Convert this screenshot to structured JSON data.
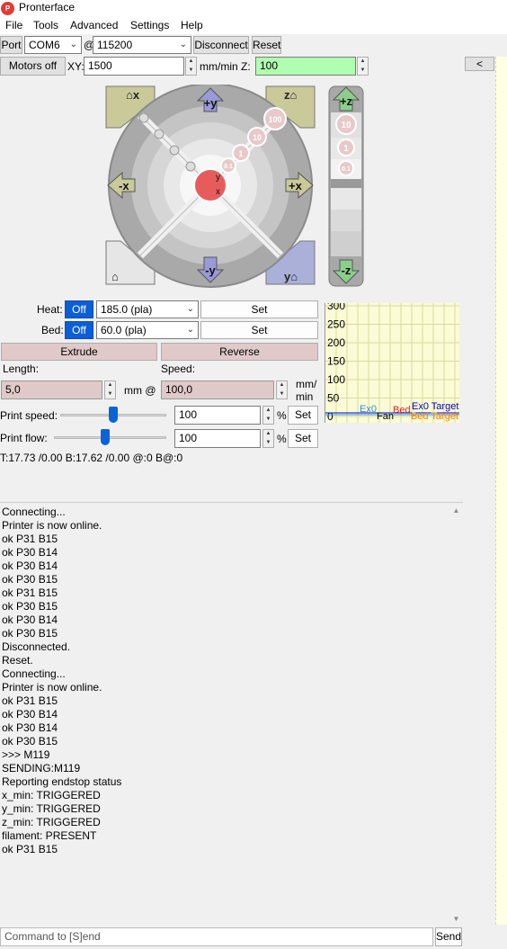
{
  "window": {
    "title": "Pronterface",
    "icon_text": "P"
  },
  "menu": [
    "File",
    "Tools",
    "Advanced",
    "Settings",
    "Help"
  ],
  "toolbar": {
    "port_label": "Port",
    "port_value": "COM6",
    "at": "@",
    "baud_value": "115200",
    "disconnect": "Disconnect",
    "reset": "Reset",
    "collapse": "<"
  },
  "motion": {
    "motors_off": "Motors off",
    "xy_label": "XY:",
    "xy_value": "1500",
    "units_label": "mm/min Z:",
    "z_value": "100"
  },
  "jog": {
    "home_x": "x",
    "home_z": "z",
    "home_y": "y",
    "home_all": "⌂",
    "plus_y": "+y",
    "minus_y": "-y",
    "plus_x": "+x",
    "minus_x": "-x",
    "center_y": "y",
    "center_x": "x",
    "steps": [
      "100",
      "10",
      "1",
      "0.1"
    ],
    "plus_z": "+z",
    "minus_z": "-z",
    "z_steps": [
      "10",
      "1",
      "0.1"
    ]
  },
  "temps": {
    "heat_label": "Heat:",
    "heat_off": "Off",
    "heat_value": "185.0 (pla)",
    "heat_set": "Set",
    "bed_label": "Bed:",
    "bed_off": "Off",
    "bed_value": "60.0 (pla)",
    "bed_set": "Set"
  },
  "extrude": {
    "extrude": "Extrude",
    "reverse": "Reverse",
    "length_label": "Length:",
    "speed_label": "Speed:",
    "length_value": "5,0",
    "length_unit": "mm @",
    "speed_value": "100,0",
    "speed_unit_1": "mm/",
    "speed_unit_2": "min"
  },
  "print_speed": {
    "label": "Print speed:",
    "value": "100",
    "unit": "%",
    "set": "Set",
    "level": 0.5
  },
  "print_flow": {
    "label": "Print flow:",
    "value": "100",
    "unit": "%",
    "set": "Set",
    "level": 0.45
  },
  "status": "T:17.73 /0.00 B:17.62 /0.00 @:0 B@:0",
  "graph": {
    "y_ticks": [
      "300",
      "250",
      "200",
      "150",
      "100",
      "50",
      "0"
    ],
    "legend": [
      {
        "text": "Ex0",
        "color": "#2a8fe6"
      },
      {
        "text": "Fan",
        "color": "#000000"
      },
      {
        "text": "Bed",
        "color": "#e02020"
      },
      {
        "text": "Ex0 Target",
        "color": "#0000cc"
      },
      {
        "text": "Bed Target",
        "color": "#ff8000"
      }
    ],
    "accent": "#fbfbd6"
  },
  "console": [
    "Connecting...",
    "Printer is now online.",
    "ok P31 B15",
    "ok P30 B14",
    "ok P30 B14",
    "ok P30 B15",
    "ok P31 B15",
    "ok P30 B15",
    "ok P30 B14",
    "ok P30 B15",
    "Disconnected.",
    "Reset.",
    "Connecting...",
    "Printer is now online.",
    "ok P31 B15",
    "ok P30 B14",
    "ok P30 B14",
    "ok P30 B15",
    ">>> M119",
    "SENDING:M119",
    "Reporting endstop status",
    "x_min: TRIGGERED",
    "y_min: TRIGGERED",
    "z_min: TRIGGERED",
    "filament: PRESENT",
    "ok P31 B15"
  ],
  "command": {
    "placeholder": "Command to [S]end",
    "send": "Send"
  }
}
